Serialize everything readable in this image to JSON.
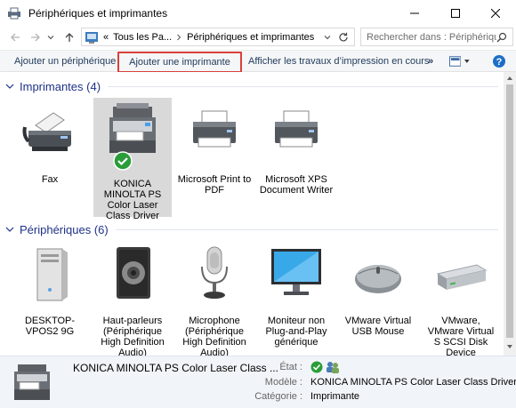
{
  "window": {
    "title": "Périphériques et imprimantes"
  },
  "address": {
    "prefix": "«",
    "crumbs": [
      "Tous les Pa...",
      "Périphériques et imprimantes"
    ],
    "search_placeholder": "Rechercher dans : Périphériqu..."
  },
  "toolbar": {
    "add_device": "Ajouter un périphérique",
    "add_printer": "Ajouter une imprimante",
    "print_jobs": "Afficher les travaux d’impression en cours",
    "more": "»"
  },
  "sections": {
    "printers": {
      "label": "Imprimantes (4)",
      "items": [
        {
          "caption": "Fax",
          "icon": "fax-icon"
        },
        {
          "caption": "KONICA MINOLTA PS Color Laser Class Driver",
          "icon": "multifunction-printer-icon",
          "selected": true,
          "default_badge": "check-badge-icon"
        },
        {
          "caption": "Microsoft Print to PDF",
          "icon": "printer-icon"
        },
        {
          "caption": "Microsoft XPS Document Writer",
          "icon": "printer-icon"
        }
      ]
    },
    "devices": {
      "label": "Périphériques (6)",
      "items": [
        {
          "caption": "DESKTOP-VPOS2 9G",
          "icon": "computer-tower-icon"
        },
        {
          "caption": "Haut-parleurs (Périphérique High Definition Audio)",
          "icon": "speaker-icon"
        },
        {
          "caption": "Microphone (Périphérique High Definition Audio)",
          "icon": "microphone-icon"
        },
        {
          "caption": "Moniteur non Plug-and-Play générique",
          "icon": "monitor-icon"
        },
        {
          "caption": "VMware Virtual USB Mouse",
          "icon": "mouse-icon"
        },
        {
          "caption": "VMware, VMware Virtual S SCSI Disk Device",
          "icon": "disk-drive-icon"
        }
      ]
    }
  },
  "details": {
    "name": "KONICA MINOLTA PS Color Laser Class ...",
    "state_label": "État :",
    "model_label": "Modèle :",
    "model_value": "KONICA MINOLTA PS Color Laser Class Driver",
    "category_label": "Catégorie :",
    "category_value": "Imprimante"
  },
  "colors": {
    "accent": "#1e3287",
    "highlight_border": "#d9403a",
    "selected_bg": "#d9d9d9",
    "check_green": "#2a9d3a"
  }
}
